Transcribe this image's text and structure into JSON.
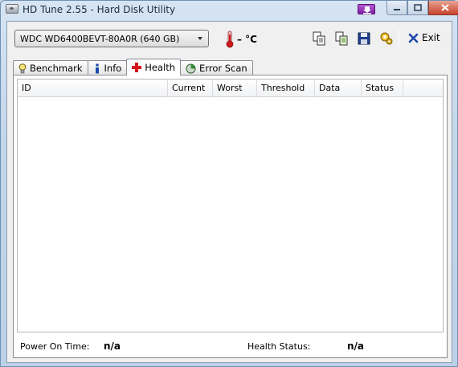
{
  "window": {
    "title": "HD Tune 2.55 - Hard Disk Utility"
  },
  "toolbar": {
    "drive": "WDC WD6400BEVT-80A0R (640 GB)",
    "temperature": "– °C",
    "exit_label": "Exit"
  },
  "tabs": [
    {
      "label": "Benchmark"
    },
    {
      "label": "Info"
    },
    {
      "label": "Health",
      "active": true
    },
    {
      "label": "Error Scan"
    }
  ],
  "table": {
    "columns": [
      "ID",
      "Current",
      "Worst",
      "Threshold",
      "Data",
      "Status"
    ],
    "rows": []
  },
  "status": {
    "power_on_label": "Power On Time:",
    "power_on_value": "n/a",
    "health_label": "Health Status:",
    "health_value": "n/a"
  },
  "colors": {
    "minimize_highlight": "#9b3fc0",
    "close_button": "#c7412a"
  },
  "icons": [
    "app-disk-icon",
    "thermometer-icon",
    "copy-icon",
    "copy-all-icon",
    "save-icon",
    "options-icon",
    "exit-x-icon",
    "benchmark-bulb-icon",
    "info-icon",
    "health-cross-icon",
    "error-scan-icon"
  ]
}
